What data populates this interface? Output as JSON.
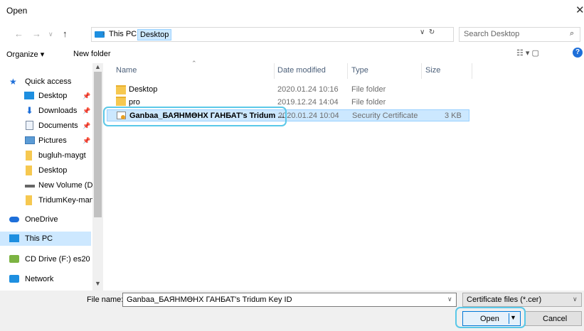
{
  "window": {
    "title": "Open",
    "close_glyph": "✕"
  },
  "nav_buttons": {
    "back": "←",
    "forward": "→",
    "recent": "∨",
    "up": "↑"
  },
  "address": {
    "crumbs": [
      "This PC",
      "Desktop"
    ],
    "separator": "›"
  },
  "search": {
    "placeholder": "Search Desktop"
  },
  "toolbar": {
    "organize": "Organize ▾",
    "new_folder": "New folder",
    "view": "☷ ▾    ▢",
    "help": "?"
  },
  "sidebar": {
    "items": [
      {
        "label": "Quick access",
        "icon": "star-icon"
      },
      {
        "label": "Desktop",
        "icon": "desktop-icon",
        "pinned": true
      },
      {
        "label": "Downloads",
        "icon": "download-icon",
        "pinned": true
      },
      {
        "label": "Documents",
        "icon": "documents-icon",
        "pinned": true
      },
      {
        "label": "Pictures",
        "icon": "pictures-icon",
        "pinned": true
      },
      {
        "label": "bugluh-maygt",
        "icon": "folder-icon"
      },
      {
        "label": "Desktop",
        "icon": "folder-icon"
      },
      {
        "label": "New Volume (D:",
        "icon": "drive-icon"
      },
      {
        "label": "TridumKey-man",
        "icon": "folder-icon"
      },
      {
        "label": "OneDrive",
        "icon": "cloud-icon"
      },
      {
        "label": "This PC",
        "icon": "computer-icon",
        "selected": true
      },
      {
        "label": "CD Drive (F:) es20",
        "icon": "cd-drive-icon"
      },
      {
        "label": "Network",
        "icon": "network-icon"
      }
    ]
  },
  "columns": [
    "Name",
    "Date modified",
    "Type",
    "Size"
  ],
  "files": [
    {
      "name": "Desktop",
      "date": "2020.01.24 10:16",
      "type": "File folder",
      "size": ""
    },
    {
      "name": "pro",
      "date": "2019.12.24 14:04",
      "type": "File folder",
      "size": ""
    },
    {
      "name": "Ganbaa_БАЯНМӨНХ ГАНБАТ's Tridum ...",
      "date": "2020.01.24 10:04",
      "type": "Security Certificate",
      "size": "3 KB"
    }
  ],
  "bottom": {
    "file_name_label": "File name:",
    "file_name_value": "Ganbaa_БАЯНМӨНХ ГАНБАТ's Tridum Key ID",
    "file_type": "Certificate files (*.cer)",
    "open": "Open",
    "cancel": "Cancel"
  },
  "colors": {
    "accent": "#0078d7",
    "selection": "#cce8ff",
    "highlight": "#5bc8e8"
  }
}
